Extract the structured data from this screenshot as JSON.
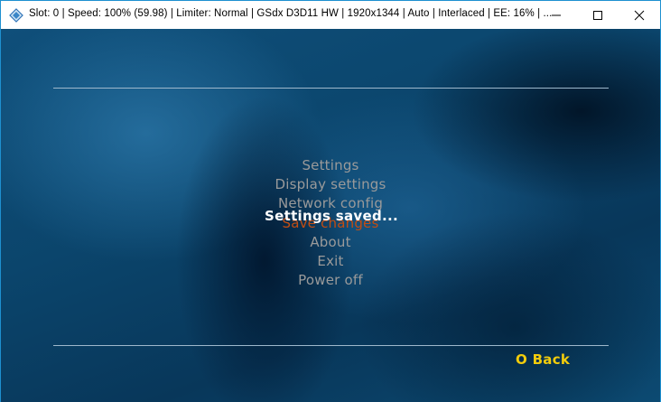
{
  "window": {
    "title": "Slot: 0 | Speed: 100% (59.98) | Limiter: Normal | GSdx D3D11 HW | 1920x1344 | Auto | Interlaced | EE:  16% | ...",
    "app_icon": "pcsx2-diamond-icon",
    "controls": [
      "minimize-icon",
      "maximize-icon",
      "close-icon"
    ]
  },
  "menu": {
    "items": [
      {
        "label": "Settings"
      },
      {
        "label": "Display settings"
      },
      {
        "label": "Network config"
      },
      {
        "label": "Save changes",
        "selected": true
      },
      {
        "label": "About"
      },
      {
        "label": "Exit"
      },
      {
        "label": "Power off"
      }
    ]
  },
  "toast": {
    "text": "Settings saved..."
  },
  "footer": {
    "back_label": "O Back"
  },
  "colors": {
    "menu_text": "#9a9a9a",
    "selected_text": "#c24d12",
    "toast_text": "#ffffff",
    "back_text": "#f2cc0c",
    "divider": "#9eb8cc"
  }
}
